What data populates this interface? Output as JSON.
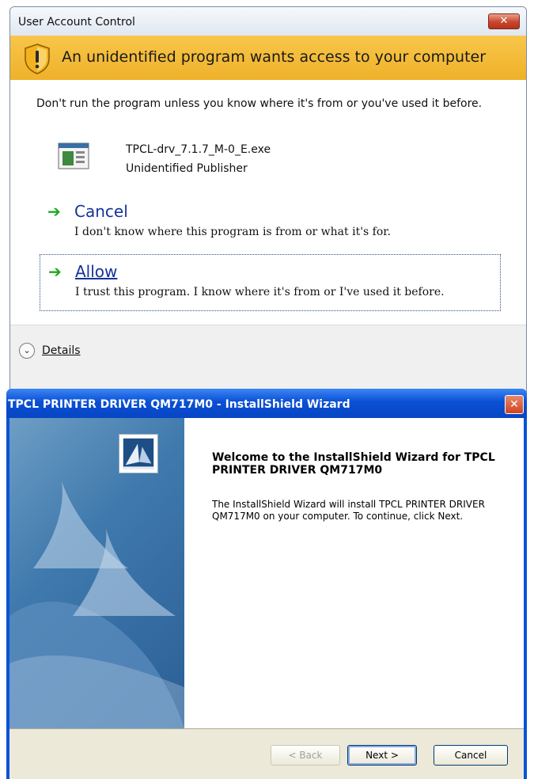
{
  "uac": {
    "title": "User Account Control",
    "close_glyph": "✕",
    "banner_icon": "shield-warning-icon",
    "heading": "An unidentified program wants access to your computer",
    "warning": "Don't run the program unless you know where it's from or you've used it before.",
    "program": {
      "icon": "program-icon",
      "name": "TPCL-drv_7.1.7_M-0_E.exe",
      "publisher": "Unidentified Publisher"
    },
    "options": {
      "cancel": {
        "arrow": "➔",
        "title": "Cancel",
        "description": "I don't know where this program is from or what it's for."
      },
      "allow": {
        "arrow": "➔",
        "title": "Allow",
        "description": "I trust this program. I know where it's from or I've used it before."
      }
    },
    "details": {
      "icon": "chevron-down-icon",
      "glyph": "⌄",
      "label": "Details"
    }
  },
  "wizard": {
    "title": "TPCL PRINTER DRIVER QM717M0 - InstallShield Wizard",
    "close_glyph": "✕",
    "logo_icon": "installshield-logo-icon",
    "heading": "Welcome to the InstallShield Wizard for TPCL PRINTER DRIVER QM717M0",
    "text": "The InstallShield Wizard will install TPCL PRINTER DRIVER QM717M0 on your computer.  To continue, click Next.",
    "buttons": {
      "back": "< Back",
      "next": "Next >",
      "cancel": "Cancel"
    }
  },
  "colors": {
    "uac_banner": "#efb12a",
    "xp_titlebar": "#0a53d6",
    "option_title": "#14339a",
    "arrow_green": "#1fa81f"
  }
}
